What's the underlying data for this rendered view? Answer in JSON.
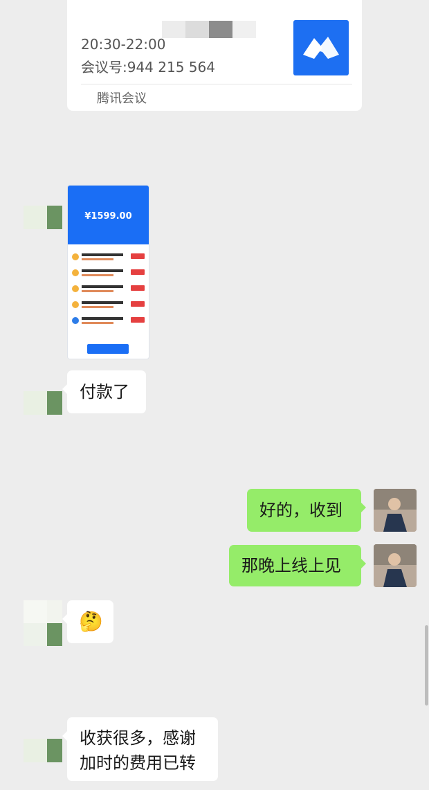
{
  "meeting_card": {
    "time": "20:30-22:00",
    "meeting_id": "会议号:944 215 564",
    "source": "腾讯会议"
  },
  "screenshot_thumb": {
    "amount": "¥1599.00"
  },
  "messages": [
    {
      "side": "left",
      "text": "付款了"
    },
    {
      "side": "right",
      "text": "好的，收到"
    },
    {
      "side": "right",
      "text": "那晚上线上见"
    },
    {
      "side": "left",
      "emoji": "🤔"
    },
    {
      "side": "left",
      "line1": "收获很多，感谢",
      "line2": "加时的费用已转"
    }
  ],
  "colors": {
    "background": "#ededed",
    "bubble_self": "#95ec69",
    "bubble_other": "#ffffff",
    "tencent_blue": "#1d6ff2"
  }
}
